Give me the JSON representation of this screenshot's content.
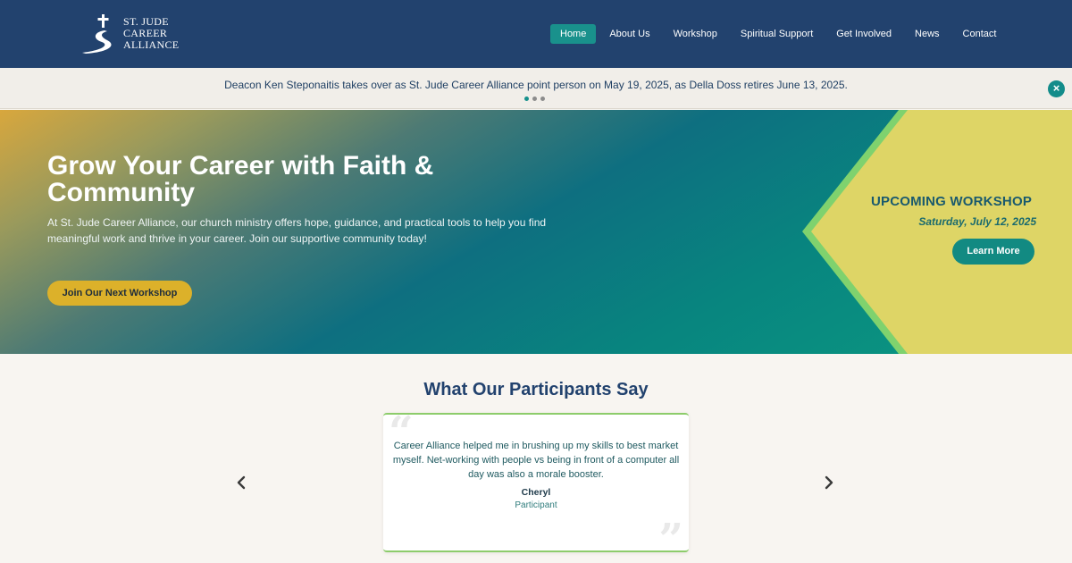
{
  "brand": {
    "line1": "ST. JUDE",
    "line2": "CAREER",
    "line3": "ALLIANCE",
    "icon": "cross-path-logo-icon"
  },
  "nav": {
    "items": [
      {
        "label": "Home",
        "active": true
      },
      {
        "label": "About Us",
        "active": false
      },
      {
        "label": "Workshop",
        "active": false
      },
      {
        "label": "Spiritual Support",
        "active": false
      },
      {
        "label": "Get Involved",
        "active": false
      },
      {
        "label": "News",
        "active": false
      },
      {
        "label": "Contact",
        "active": false
      }
    ]
  },
  "announcement": {
    "text": "Deacon Ken Steponaitis takes over as St. Jude Career Alliance point person on May 19, 2025, as Della Doss retires June 13, 2025.",
    "slides": 3,
    "active_slide": 1,
    "close_icon": "close-icon"
  },
  "hero": {
    "title": "Grow Your Career with Faith & Community",
    "description": "At St. Jude Career Alliance, our church ministry offers hope, guidance, and practical tools to help you find meaningful work and thrive in your career. Join our supportive community today!",
    "button_label": "Join Our Next Workshop",
    "upcoming_label": "UPCOMING WORKSHOP",
    "upcoming_date": "Saturday, July 12, 2025",
    "learn_more_label": "Learn More"
  },
  "testimonials": {
    "heading": "What Our Participants Say",
    "prev_icon": "chevron-left-icon",
    "next_icon": "chevron-right-icon",
    "items": [
      {
        "quote": "Career Alliance helped me in brushing up my skills to best market myself. Net-working with people vs being in front of a computer all day was also a morale booster.",
        "name": "Cheryl",
        "role": "Participant"
      }
    ]
  },
  "colors": {
    "header_bg": "#22426e",
    "accent_teal": "#19918c",
    "hero_button": "#dcb12a",
    "upcoming_panel": "#ded566",
    "card_border": "#8dcc6b"
  }
}
